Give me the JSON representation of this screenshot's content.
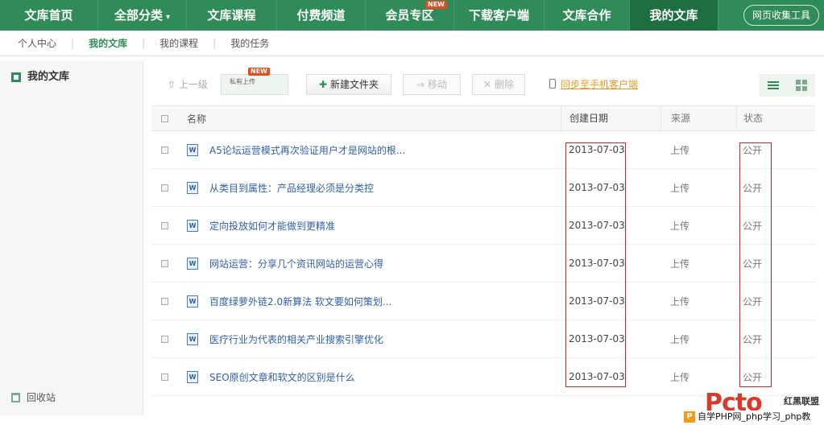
{
  "topnav": {
    "items": [
      {
        "label": "文库首页"
      },
      {
        "label": "全部分类",
        "caret": "▾"
      },
      {
        "label": "文库课程"
      },
      {
        "label": "付费频道"
      },
      {
        "label": "会员专区",
        "badge": "NEW"
      },
      {
        "label": "下载客户端"
      },
      {
        "label": "文库合作"
      },
      {
        "label": "我的文库",
        "active": true
      }
    ],
    "tool_button": "网页收集工具"
  },
  "subnav": {
    "items": [
      "个人中心",
      "我的文库",
      "我的课程",
      "我的任务"
    ],
    "separator": "|",
    "active_index": 1
  },
  "sidebar": {
    "title": "我的文库",
    "recycle": "回收站"
  },
  "toolbar": {
    "up": "上一级",
    "private_upload": "私有上传",
    "private_badge": "NEW",
    "new_folder": "新建文件夹",
    "move": "移动",
    "delete": "删除",
    "sync": "同步至手机客户端",
    "up_arrow": "⇧",
    "move_arrow": "⇒",
    "delete_mark": "✕",
    "plus": "✚"
  },
  "table": {
    "headers": {
      "name": "名称",
      "date": "创建日期",
      "source": "来源",
      "status": "状态"
    },
    "rows": [
      {
        "title": "A5论坛运营模式再次验证用户才是网站的根...",
        "date": "2013-07-03",
        "source": "上传",
        "status": "公开"
      },
      {
        "title": "从类目到属性：产品经理必须是分类控",
        "date": "2013-07-03",
        "source": "上传",
        "status": "公开"
      },
      {
        "title": "定向投放如何才能做到更精准",
        "date": "2013-07-03",
        "source": "上传",
        "status": "公开"
      },
      {
        "title": "网站运营：分享几个资讯网站的运营心得",
        "date": "2013-07-03",
        "source": "上传",
        "status": "公开"
      },
      {
        "title": "百度绿萝外链2.0新算法 软文要如何策划...",
        "date": "2013-07-03",
        "source": "上传",
        "status": "公开"
      },
      {
        "title": "医疗行业为代表的相关产业搜索引擎优化",
        "date": "2013-07-03",
        "source": "上传",
        "status": "公开"
      },
      {
        "title": "SEO原创文章和软文的区别是什么",
        "date": "2013-07-03",
        "source": "上传",
        "status": "公开"
      }
    ],
    "doc_icon": "W"
  },
  "watermark": {
    "logo": "Pcto",
    "brand": "红黑联盟",
    "badge": "P",
    "text": "自学PHP网_php学习_php教"
  },
  "colors": {
    "nav_green": "#2f8c59",
    "active_green": "#1e6e42",
    "link_blue": "#2f5ea8",
    "highlight_red": "#c62828",
    "sync_orange": "#e39b1d"
  }
}
